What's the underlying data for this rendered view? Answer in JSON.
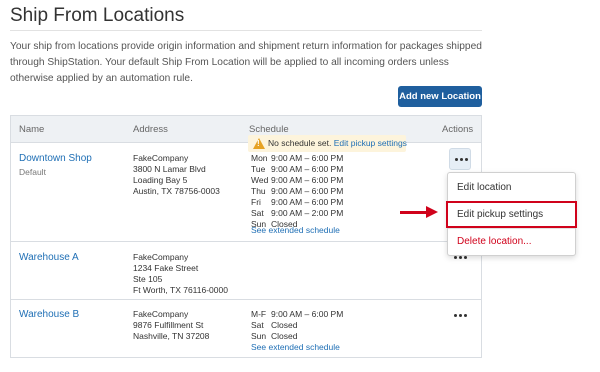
{
  "page": {
    "title": "Ship From Locations",
    "intro": "Your ship from locations provide origin information and shipment return information for packages shipped through ShipStation. Your default Ship From Location will be applied to all incoming orders unless otherwise applied by an automation rule.",
    "add_button": "Add new Location"
  },
  "table": {
    "headers": {
      "name": "Name",
      "address": "Address",
      "schedule": "Schedule",
      "actions": "Actions"
    },
    "rows": [
      {
        "name": "Downtown Shop",
        "badge": "Default",
        "address": [
          "FakeCompany",
          "3800 N Lamar Blvd",
          "Loading Bay 5",
          "Austin, TX 78756-0003"
        ],
        "schedule": [
          {
            "day": "Mon",
            "hours": "9:00 AM – 6:00 PM"
          },
          {
            "day": "Tue",
            "hours": "9:00 AM – 6:00 PM"
          },
          {
            "day": "Wed",
            "hours": "9:00 AM – 6:00 PM"
          },
          {
            "day": "Thu",
            "hours": "9:00 AM – 6:00 PM"
          },
          {
            "day": "Fri",
            "hours": "9:00 AM – 6:00 PM"
          },
          {
            "day": "Sat",
            "hours": "9:00 AM – 2:00 PM"
          },
          {
            "day": "Sun",
            "hours": "Closed"
          }
        ],
        "schedule_link": "See extended schedule"
      },
      {
        "name": "Warehouse A",
        "address": [
          "FakeCompany",
          "1234 Fake Street",
          "Ste 105",
          "Ft Worth, TX 76116-0000"
        ],
        "warning_text": "No schedule set.",
        "warning_link": "Edit pickup settings"
      },
      {
        "name": "Warehouse B",
        "address": [
          "FakeCompany",
          "9876 Fulfillment St",
          "Nashville, TN 37208"
        ],
        "schedule": [
          {
            "day": "M-F",
            "hours": "9:00 AM – 6:00 PM"
          },
          {
            "day": "Sat",
            "hours": "Closed"
          },
          {
            "day": "Sun",
            "hours": "Closed"
          }
        ],
        "schedule_link": "See extended schedule"
      }
    ]
  },
  "menu": {
    "items": [
      {
        "label": "Edit location",
        "color": "#333333"
      },
      {
        "label": "Edit pickup settings",
        "color": "#333333"
      },
      {
        "label": "Delete location...",
        "color": "#d0021b"
      }
    ]
  },
  "colors": {
    "link": "#1f6fb5",
    "primary": "#1f5f9e",
    "annotation": "#d0021b",
    "warning": "#e6a224"
  }
}
